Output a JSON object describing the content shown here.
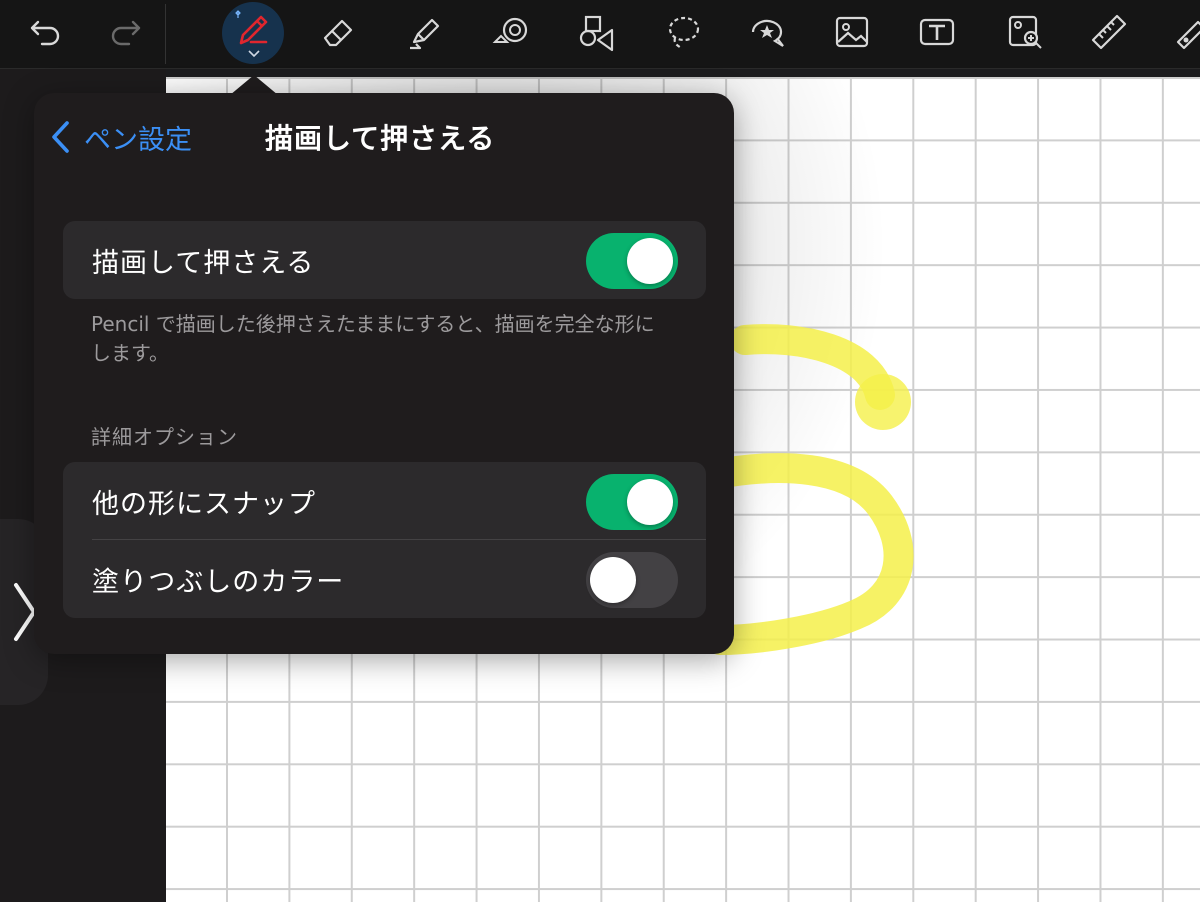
{
  "toolbar": {
    "tools": [
      {
        "id": "undo",
        "icon": "undo-icon"
      },
      {
        "id": "redo",
        "icon": "redo-icon"
      },
      {
        "id": "pen",
        "icon": "pen-icon",
        "active": true
      },
      {
        "id": "eraser",
        "icon": "eraser-icon"
      },
      {
        "id": "highlighter",
        "icon": "highlighter-icon"
      },
      {
        "id": "shape-fill",
        "icon": "shape-fill-icon"
      },
      {
        "id": "shapes",
        "icon": "shapes-icon"
      },
      {
        "id": "lasso",
        "icon": "lasso-icon"
      },
      {
        "id": "elements",
        "icon": "sticker-icon"
      },
      {
        "id": "image",
        "icon": "image-icon"
      },
      {
        "id": "text",
        "icon": "text-box-icon"
      },
      {
        "id": "image-search",
        "icon": "image-search-icon"
      },
      {
        "id": "ruler",
        "icon": "ruler-icon"
      },
      {
        "id": "laser",
        "icon": "laser-pointer-icon"
      }
    ]
  },
  "popover": {
    "back_label": "ペン設定",
    "title": "描画して押さえる",
    "main_toggle": {
      "label": "描画して押さえる",
      "on": true
    },
    "footnote": "Pencil で描画した後押さえたままにすると、描画を完全な形にします。",
    "advanced_header": "詳細オプション",
    "options": [
      {
        "label": "他の形にスナップ",
        "on": true
      },
      {
        "label": "塗りつぶしのカラー",
        "on": false
      }
    ]
  },
  "colors": {
    "accent_blue": "#3b8ff5",
    "toggle_on": "#08b26e",
    "toggle_off": "#434144",
    "ink_yellow": "#f5f04a",
    "pen_red": "#e0262e"
  }
}
